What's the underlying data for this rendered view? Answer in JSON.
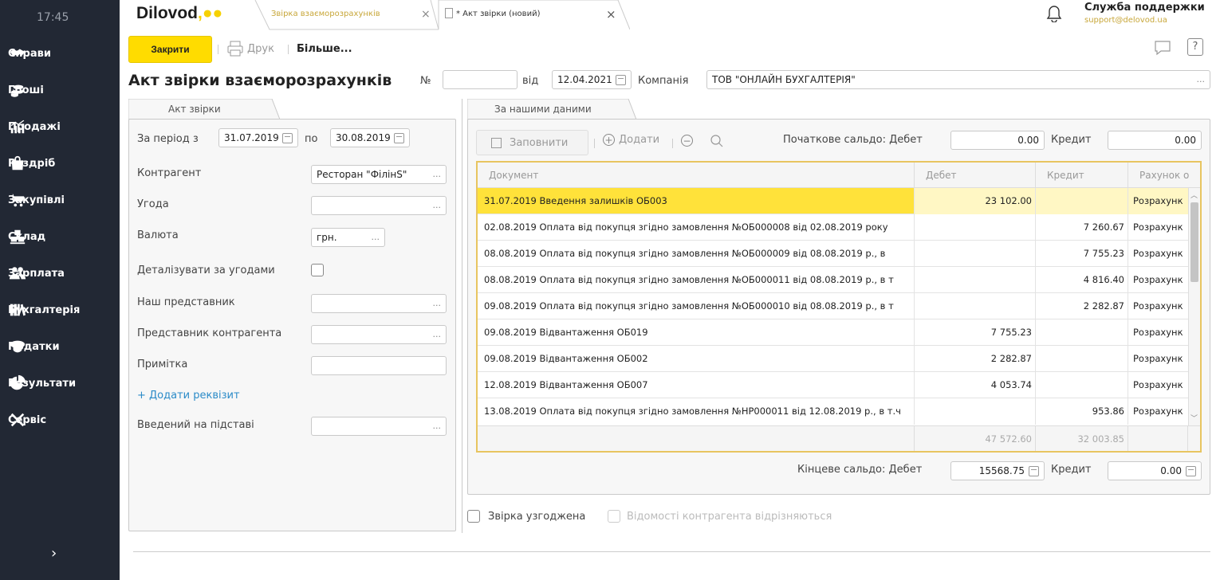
{
  "sidebar": {
    "time": "17:45",
    "items": [
      {
        "label": "Справи",
        "icon": "handshake-icon"
      },
      {
        "label": "Гроші",
        "icon": "coins-icon"
      },
      {
        "label": "Продажі",
        "icon": "sales-chart-icon"
      },
      {
        "label": "Роздріб",
        "icon": "shopping-bag-icon"
      },
      {
        "label": "Закупівлі",
        "icon": "cart-icon"
      },
      {
        "label": "Склад",
        "icon": "boxes-icon"
      },
      {
        "label": "Зарплата",
        "icon": "people-icon"
      },
      {
        "label": "Бухгалтерія",
        "icon": "books-icon"
      },
      {
        "label": "Податки",
        "icon": "cap-icon"
      },
      {
        "label": "Результати",
        "icon": "pie-chart-icon"
      },
      {
        "label": "Сервіс",
        "icon": "tools-icon"
      }
    ],
    "expand": "›"
  },
  "topbar": {
    "logo": "Dilovod",
    "logo_dots": ",●●",
    "tabs": [
      {
        "label": "Звірка взаєморозрахунків"
      },
      {
        "label": "* Акт звірки (новий)"
      }
    ],
    "close_glyph": "×",
    "support_title": "Служба поддержки",
    "support_mail": "support@delovod.ua"
  },
  "toolbar": {
    "close_label": "Закрити",
    "print_label": "Друк",
    "more_label": "Більше...",
    "help_label": "?"
  },
  "header": {
    "title": "Акт звірки взаєморозрахунків",
    "number_label": "№",
    "number_value": "",
    "date_label": "від",
    "date_value": "12.04.2021",
    "company_label": "Компанія",
    "company_value": "ТОВ \"ОНЛАЙН БУХГАЛТЕРІЯ\""
  },
  "left": {
    "tab_label": "Акт звірки",
    "period_label": "За період з",
    "period_from": "31.07.2019",
    "period_to_label": "по",
    "period_to": "30.08.2019",
    "counterparty_label": "Контрагент",
    "counterparty_value": "Ресторан \"ФілінS\"",
    "agreement_label": "Угода",
    "agreement_value": "",
    "currency_label": "Валюта",
    "currency_value": "грн.",
    "detail_label": "Деталізувати за угодами",
    "our_rep_label": "Наш представник",
    "cp_rep_label": "Представник контрагента",
    "note_label": "Примітка",
    "add_req_label": "+ Додати реквізит",
    "basis_label": "Введений на підставі",
    "dots": "..."
  },
  "right": {
    "tab_label": "За нашими даними",
    "fill_label": "Заповнити",
    "add_label": "Додати",
    "opening_debit_label": "Початкове сальдо: Дебет",
    "opening_debit_value": "0.00",
    "credit_label": "Кредит",
    "opening_credit_value": "0.00",
    "closing_debit_label": "Кінцеве сальдо: Дебет",
    "closing_debit_value": "15568.75",
    "closing_credit_value": "0.00",
    "columns": [
      "Документ",
      "Дебет",
      "Кредит",
      "Рахунок о"
    ],
    "rows": [
      {
        "doc": "31.07.2019 Введення залишків ОБ003",
        "debit": "23 102.00",
        "credit": "",
        "account": "Розрахунк"
      },
      {
        "doc": "02.08.2019 Оплата від покупця згідно замовлення №ОБ000008 від 02.08.2019 року",
        "debit": "",
        "credit": "7 260.67",
        "account": "Розрахунк"
      },
      {
        "doc": "08.08.2019 Оплата від покупця згідно замовлення №ОБ000009 від 08.08.2019 р., в",
        "debit": "",
        "credit": "7 755.23",
        "account": "Розрахунк"
      },
      {
        "doc": "08.08.2019 Оплата від покупця згідно замовлення №ОБ000011 від 08.08.2019 р., в т",
        "debit": "",
        "credit": "4 816.40",
        "account": "Розрахунк"
      },
      {
        "doc": "09.08.2019 Оплата від покупця згідно замовлення №ОБ000010 від 08.08.2019 р., в т",
        "debit": "",
        "credit": "2 282.87",
        "account": "Розрахунк"
      },
      {
        "doc": "09.08.2019 Відвантаження ОБ019",
        "debit": "7 755.23",
        "credit": "",
        "account": "Розрахунк"
      },
      {
        "doc": "09.08.2019 Відвантаження ОБ002",
        "debit": "2 282.87",
        "credit": "",
        "account": "Розрахунк"
      },
      {
        "doc": "12.08.2019 Відвантаження ОБ007",
        "debit": "4 053.74",
        "credit": "",
        "account": "Розрахунк"
      },
      {
        "doc": "13.08.2019 Оплата від покупця згідно замовлення №НР000011 від 12.08.2019 р., в т.ч",
        "debit": "",
        "credit": "953.86",
        "account": "Розрахунк"
      }
    ],
    "total_debit": "47 572.60",
    "total_credit": "32 003.85",
    "agreed_label": "Звірка узгоджена",
    "differs_label": "Відомості контрагента відрізняються"
  },
  "colors": {
    "accent": "#ffdc00",
    "sidebar": "#222834",
    "link": "#2b8bc8"
  }
}
